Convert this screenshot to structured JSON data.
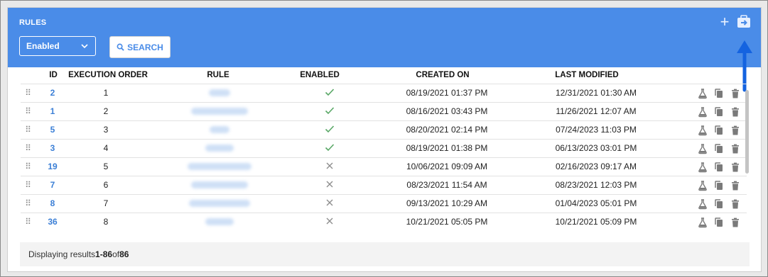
{
  "header": {
    "title": "RULES",
    "filter": {
      "selected": "Enabled"
    },
    "search_label": "SEARCH",
    "add_icon": "plus-icon",
    "export_icon": "export-briefcase-icon",
    "accent_color": "#4a8ce8"
  },
  "table": {
    "columns": [
      "ID",
      "EXECUTION ORDER",
      "RULE",
      "ENABLED",
      "CREATED ON",
      "LAST MODIFIED"
    ],
    "rows": [
      {
        "id": "2",
        "order": "1",
        "enabled": true,
        "created": "08/19/2021 01:37 PM",
        "modified": "12/31/2021 01:30 AM"
      },
      {
        "id": "1",
        "order": "2",
        "enabled": true,
        "created": "08/16/2021 03:43 PM",
        "modified": "11/26/2021 12:07 AM"
      },
      {
        "id": "5",
        "order": "3",
        "enabled": true,
        "created": "08/20/2021 02:14 PM",
        "modified": "07/24/2023 11:03 PM"
      },
      {
        "id": "3",
        "order": "4",
        "enabled": true,
        "created": "08/19/2021 01:38 PM",
        "modified": "06/13/2023 03:01 PM"
      },
      {
        "id": "19",
        "order": "5",
        "enabled": false,
        "created": "10/06/2021 09:09 AM",
        "modified": "02/16/2023 09:17 AM"
      },
      {
        "id": "7",
        "order": "6",
        "enabled": false,
        "created": "08/23/2021 11:54 AM",
        "modified": "08/23/2021 12:03 PM"
      },
      {
        "id": "8",
        "order": "7",
        "enabled": false,
        "created": "09/13/2021 10:29 AM",
        "modified": "01/04/2023 05:01 PM"
      },
      {
        "id": "36",
        "order": "8",
        "enabled": false,
        "created": "10/21/2021 05:05 PM",
        "modified": "10/21/2021 05:09 PM"
      }
    ],
    "row_actions": [
      "flask-icon",
      "copy-icon",
      "trash-icon"
    ]
  },
  "footer": {
    "prefix": "Displaying results ",
    "range": "1-86",
    "of": " of ",
    "total": "86"
  }
}
